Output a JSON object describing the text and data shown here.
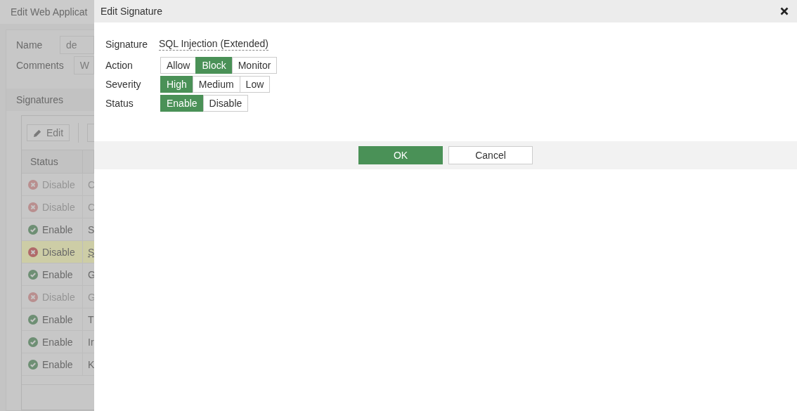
{
  "background": {
    "title": "Edit Web Applicat",
    "fields": [
      {
        "label": "Name",
        "value": "de"
      },
      {
        "label": "Comments",
        "value": "W"
      }
    ],
    "section": "Signatures",
    "edit_button": "Edit",
    "table": {
      "columns": [
        "Status"
      ],
      "rows": [
        {
          "status": "Disable",
          "kind": "disabled",
          "column_2": "C",
          "dimmed": true,
          "selected": false
        },
        {
          "status": "Disable",
          "kind": "disabled",
          "column_2": "C",
          "dimmed": true,
          "selected": false
        },
        {
          "status": "Enable",
          "kind": "enabled",
          "column_2": "S",
          "dimmed": false,
          "selected": false
        },
        {
          "status": "Disable",
          "kind": "disabled",
          "column_2": "S",
          "dimmed": false,
          "selected": true
        },
        {
          "status": "Enable",
          "kind": "enabled",
          "column_2": "G",
          "dimmed": false,
          "selected": false
        },
        {
          "status": "Disable",
          "kind": "disabled",
          "column_2": "G",
          "dimmed": true,
          "selected": false
        },
        {
          "status": "Enable",
          "kind": "enabled",
          "column_2": "T",
          "dimmed": false,
          "selected": false
        },
        {
          "status": "Enable",
          "kind": "enabled",
          "column_2": "Ir",
          "dimmed": false,
          "selected": false
        },
        {
          "status": "Enable",
          "kind": "enabled",
          "column_2": "K",
          "dimmed": false,
          "selected": false
        }
      ]
    }
  },
  "dialog": {
    "title": "Edit Signature",
    "signature": {
      "label": "Signature",
      "value": "SQL Injection (Extended)"
    },
    "options": [
      {
        "label": "Action",
        "choices": [
          {
            "label": "Allow",
            "selected": false
          },
          {
            "label": "Block",
            "selected": true
          },
          {
            "label": "Monitor",
            "selected": false
          }
        ]
      },
      {
        "label": "Severity",
        "choices": [
          {
            "label": "High",
            "selected": true
          },
          {
            "label": "Medium",
            "selected": false
          },
          {
            "label": "Low",
            "selected": false
          }
        ]
      },
      {
        "label": "Status",
        "choices": [
          {
            "label": "Enable",
            "selected": true
          },
          {
            "label": "Disable",
            "selected": false
          }
        ]
      }
    ],
    "buttons": [
      {
        "label": "OK",
        "kind": "primary"
      },
      {
        "label": "Cancel",
        "kind": "secondary"
      }
    ]
  }
}
